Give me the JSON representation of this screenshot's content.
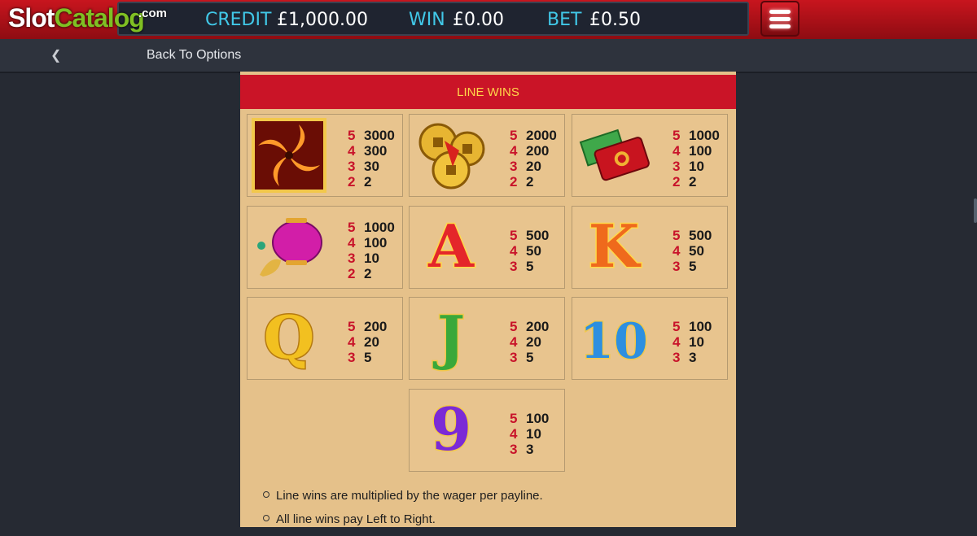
{
  "logo": {
    "part1": "Slot",
    "part2": "Catalog",
    "suffix": ".com"
  },
  "hud": {
    "credit_label": "CREDIT",
    "credit_value": "£1,000.00",
    "win_label": "WIN",
    "win_value": "£0.00",
    "bet_label": "BET",
    "bet_value": "£0.50"
  },
  "nav": {
    "back_label": "Back To Options"
  },
  "paytable": {
    "title": "LINE WINS",
    "symbols": [
      {
        "icon": "pinwheel-wild-icon",
        "pays": [
          [
            "5",
            "3000"
          ],
          [
            "4",
            "300"
          ],
          [
            "3",
            "30"
          ],
          [
            "2",
            "2"
          ]
        ]
      },
      {
        "icon": "gold-coins-icon",
        "pays": [
          [
            "5",
            "2000"
          ],
          [
            "4",
            "200"
          ],
          [
            "3",
            "20"
          ],
          [
            "2",
            "2"
          ]
        ]
      },
      {
        "icon": "red-envelope-icon",
        "pays": [
          [
            "5",
            "1000"
          ],
          [
            "4",
            "100"
          ],
          [
            "3",
            "10"
          ],
          [
            "2",
            "2"
          ]
        ]
      },
      {
        "icon": "pink-lantern-icon",
        "pays": [
          [
            "5",
            "1000"
          ],
          [
            "4",
            "100"
          ],
          [
            "3",
            "10"
          ],
          [
            "2",
            "2"
          ]
        ]
      },
      {
        "icon": "letter-a-icon",
        "glyph": "A",
        "pays": [
          [
            "5",
            "500"
          ],
          [
            "4",
            "50"
          ],
          [
            "3",
            "5"
          ]
        ]
      },
      {
        "icon": "letter-k-icon",
        "glyph": "K",
        "pays": [
          [
            "5",
            "500"
          ],
          [
            "4",
            "50"
          ],
          [
            "3",
            "5"
          ]
        ]
      },
      {
        "icon": "letter-q-icon",
        "glyph": "Q",
        "pays": [
          [
            "5",
            "200"
          ],
          [
            "4",
            "20"
          ],
          [
            "3",
            "5"
          ]
        ]
      },
      {
        "icon": "letter-j-icon",
        "glyph": "J",
        "pays": [
          [
            "5",
            "200"
          ],
          [
            "4",
            "20"
          ],
          [
            "3",
            "5"
          ]
        ]
      },
      {
        "icon": "number-10-icon",
        "glyph": "10",
        "pays": [
          [
            "5",
            "100"
          ],
          [
            "4",
            "10"
          ],
          [
            "3",
            "3"
          ]
        ]
      },
      {
        "icon": "number-9-icon",
        "glyph": "9",
        "pays": [
          [
            "5",
            "100"
          ],
          [
            "4",
            "10"
          ],
          [
            "3",
            "3"
          ]
        ]
      }
    ],
    "rules": [
      "Line wins are multiplied by the wager per payline.",
      "All line wins pay Left to Right."
    ]
  },
  "colors": {
    "accent_red": "#ca1427",
    "hud_label": "#41c8e8",
    "panel": "#e5c18a",
    "pay_count": "#c8132a"
  }
}
